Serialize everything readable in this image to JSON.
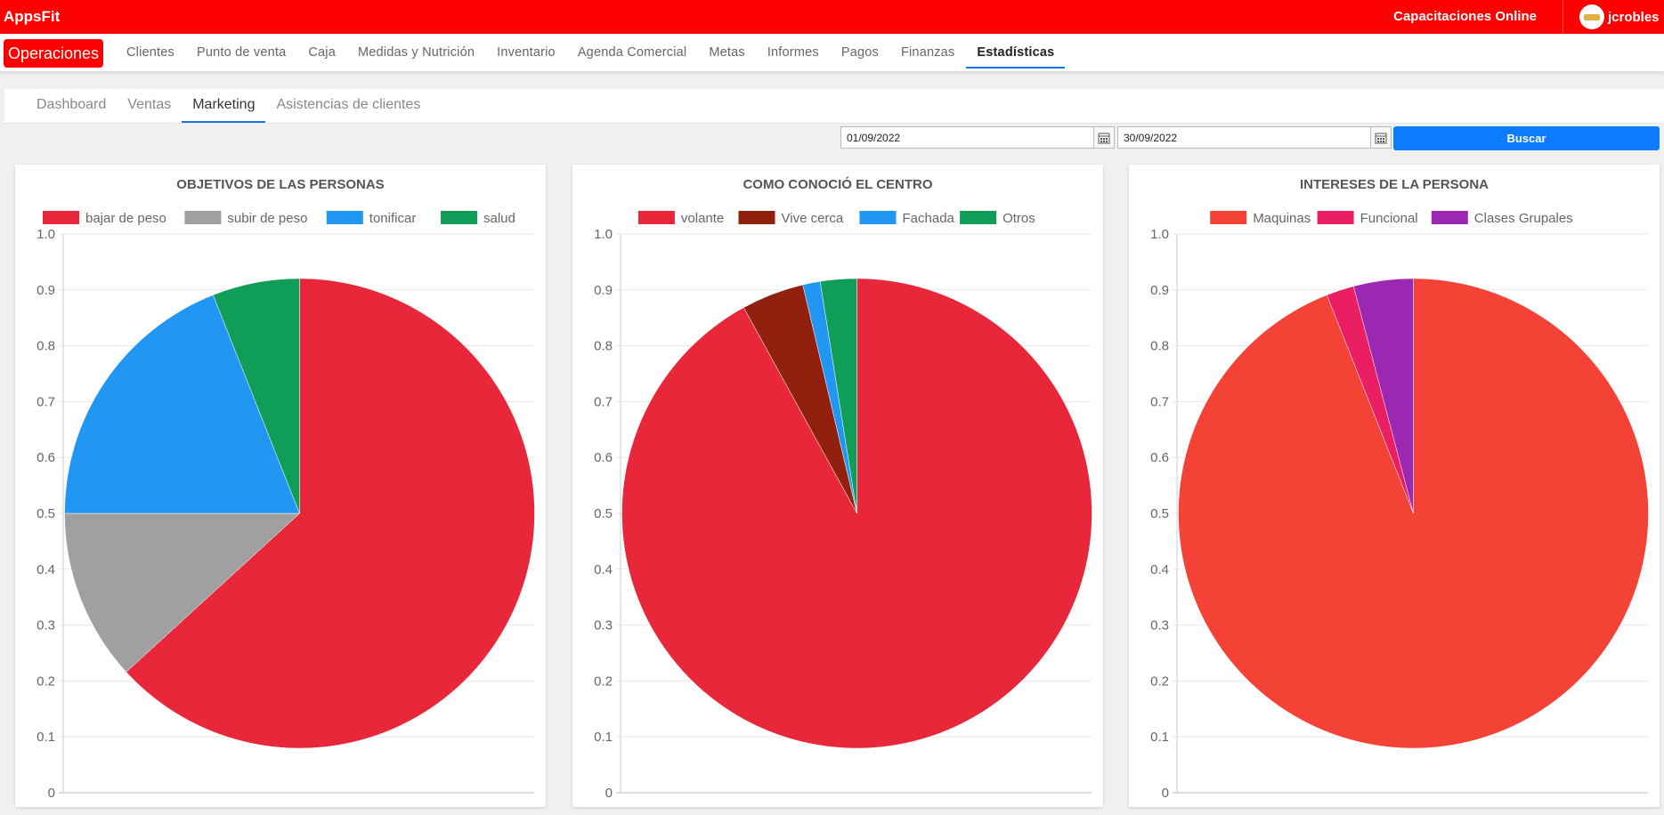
{
  "app": {
    "brand": "AppsFit",
    "top_link": "Capacitaciones Online",
    "user_name": "jcrobles"
  },
  "nav": {
    "module": "Operaciones",
    "items": [
      "Clientes",
      "Punto de venta",
      "Caja",
      "Medidas y Nutrición",
      "Inventario",
      "Agenda Comercial",
      "Metas",
      "Informes",
      "Pagos",
      "Finanzas",
      "Estadísticas"
    ],
    "active_index": 10
  },
  "subtabs": {
    "items": [
      "Dashboard",
      "Ventas",
      "Marketing",
      "Asistencias de clientes"
    ],
    "active_index": 2
  },
  "filters": {
    "date_from": "01/09/2022",
    "date_to": "30/09/2022",
    "search_label": "Buscar"
  },
  "chart_data": [
    {
      "type": "pie",
      "title": "OBJETIVOS DE LAS PERSONAS",
      "categories": [
        "bajar de peso",
        "subir de peso",
        "tonificar",
        "salud"
      ],
      "values": [
        63.2,
        11.8,
        19.0,
        6.0
      ],
      "colors": [
        "#e8283a",
        "#a0a0a0",
        "#2196f3",
        "#0f9d58"
      ],
      "yticks": [
        "1.0",
        "0.9",
        "0.8",
        "0.7",
        "0.6",
        "0.5",
        "0.4",
        "0.3",
        "0.2",
        "0.1",
        "0"
      ],
      "legend": "top"
    },
    {
      "type": "pie",
      "title": "COMO CONOCIÓ EL CENTRO",
      "categories": [
        "volante",
        "Vive cerca",
        "Fachada",
        "Otros"
      ],
      "values": [
        92.0,
        4.3,
        1.2,
        2.5
      ],
      "colors": [
        "#e8283a",
        "#91210e",
        "#2196f3",
        "#0f9d58"
      ],
      "yticks": [
        "1.0",
        "0.9",
        "0.8",
        "0.7",
        "0.6",
        "0.5",
        "0.4",
        "0.3",
        "0.2",
        "0.1",
        "0"
      ],
      "legend": "top"
    },
    {
      "type": "pie",
      "title": "INTERESES DE LA PERSONA",
      "categories": [
        "Maquinas",
        "Funcional",
        "Clases Grupales"
      ],
      "values": [
        94.0,
        1.9,
        4.1
      ],
      "colors": [
        "#f44336",
        "#e91e63",
        "#9c27b0"
      ],
      "yticks": [
        "1.0",
        "0.9",
        "0.8",
        "0.7",
        "0.6",
        "0.5",
        "0.4",
        "0.3",
        "0.2",
        "0.1",
        "0"
      ],
      "legend": "top"
    }
  ]
}
